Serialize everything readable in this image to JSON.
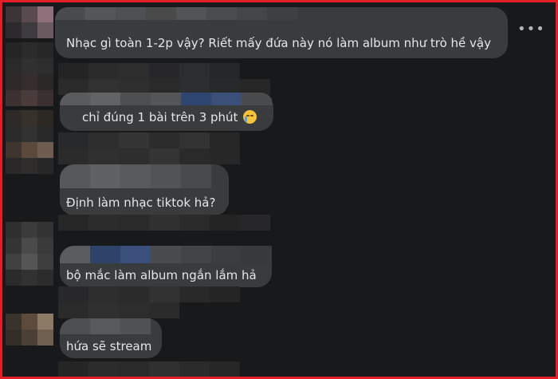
{
  "comments": [
    {
      "id": "c1",
      "text": "Nhạc gì toàn 1-2p vậy? Riết mấy đứa này nó làm album như trò hề vậy"
    },
    {
      "id": "c2",
      "text": "chỉ đúng 1 bài trên 3 phút",
      "emoji": "crying-face-emoji"
    },
    {
      "id": "c3",
      "text": "Định làm nhạc tiktok hả?"
    },
    {
      "id": "c4",
      "text": "bộ mắc làm album ngắn lắm hả"
    },
    {
      "id": "c5",
      "text": "hứa sẽ stream"
    }
  ],
  "more_options_label": "•••",
  "colors": {
    "background": "#18191a",
    "bubble": "#3a3b3c",
    "text": "#e4e6eb",
    "frame_border": "#e41e26"
  }
}
